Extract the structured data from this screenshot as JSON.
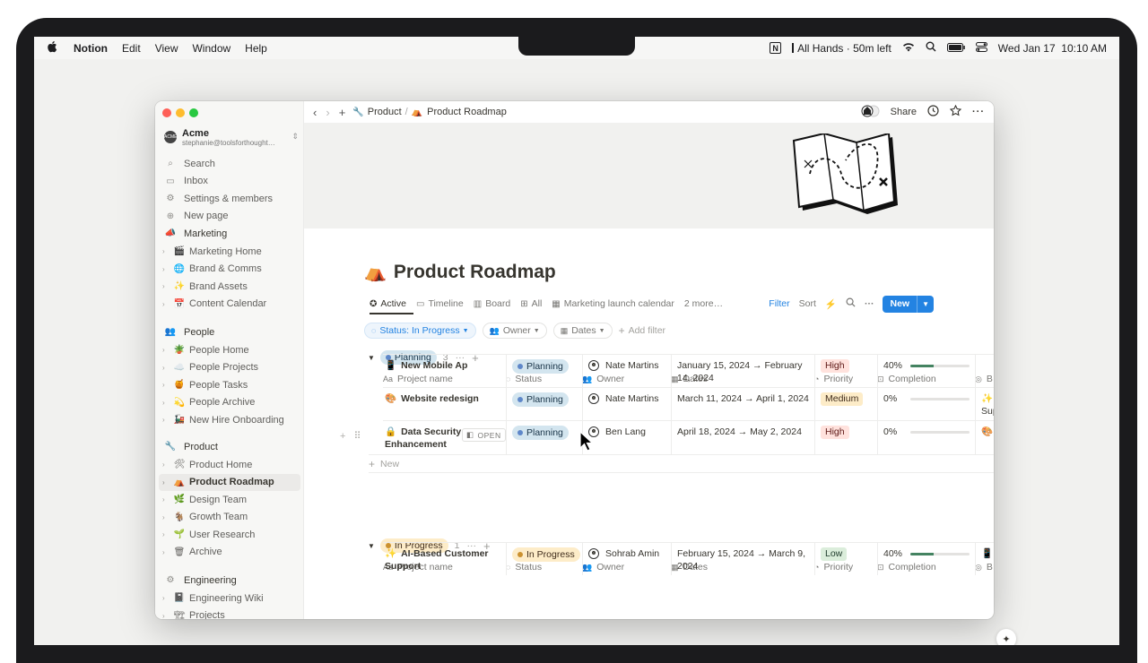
{
  "menubar": {
    "app": "Notion",
    "items": [
      "Edit",
      "View",
      "Window",
      "Help"
    ],
    "meeting": "All Hands · 50m left",
    "datetime": "Wed Jan 17  10:10 AM"
  },
  "workspace": {
    "name": "Acme",
    "email": "stephanie@toolsforthought…",
    "logo_text": "ACME"
  },
  "sidebar": {
    "top": [
      {
        "label": "Search",
        "icon": "search-icon"
      },
      {
        "label": "Inbox",
        "icon": "inbox-icon"
      },
      {
        "label": "Settings & members",
        "icon": "gear-icon"
      },
      {
        "label": "New page",
        "icon": "plus-circle-icon"
      }
    ],
    "sections": [
      {
        "title": "Marketing",
        "items": [
          "Marketing Home",
          "Brand & Comms",
          "Brand Assets",
          "Content Calendar"
        ]
      },
      {
        "title": "People",
        "items": [
          "People Home",
          "People Projects",
          "People Tasks",
          "People Archive",
          "New Hire Onboarding"
        ]
      },
      {
        "title": "Product",
        "items": [
          "Product Home",
          "Product Roadmap",
          "Design Team",
          "Growth Team",
          "User Research",
          "Archive"
        ]
      },
      {
        "title": "Engineering",
        "items": [
          "Engineering Wiki",
          "Projects"
        ]
      }
    ],
    "selected": "Product Roadmap"
  },
  "topbar": {
    "crumb_parent": "Product",
    "crumb_sep": "/",
    "crumb_current": "Product Roadmap",
    "share": "Share"
  },
  "page": {
    "title": "Product Roadmap",
    "title_icon": "⛺"
  },
  "views": {
    "tabs": [
      {
        "label": "Active",
        "icon": "target-icon"
      },
      {
        "label": "Timeline",
        "icon": "timeline-icon"
      },
      {
        "label": "Board",
        "icon": "board-icon"
      },
      {
        "label": "All",
        "icon": "table-icon"
      },
      {
        "label": "Marketing launch calendar",
        "icon": "calendar-icon"
      },
      {
        "label": "2 more…",
        "icon": ""
      }
    ],
    "active": "Active",
    "filter": "Filter",
    "sort": "Sort",
    "new": "New"
  },
  "filters": {
    "status": "Status: In Progress",
    "owner": "Owner",
    "dates": "Dates",
    "add": "Add filter"
  },
  "columns": [
    "Project name",
    "Status",
    "Owner",
    "Dates",
    "Priority",
    "Completion",
    "B"
  ],
  "groups": [
    {
      "label": "Planning",
      "count": "3",
      "rows": [
        {
          "name": "New Mobile Ap",
          "emoji": "📱",
          "status": "Planning",
          "owner": "Nate Martins",
          "dates1": "January 15, 2024 → February",
          "dates2": "14, 2024",
          "priority": "High",
          "completion": "40%",
          "completion_value": 0.4,
          "related": ""
        },
        {
          "name": "Website redesign",
          "emoji": "🎨",
          "status": "Planning",
          "owner": "Nate Martins",
          "dates1": "March 11, 2024 → April 1, 2024",
          "dates2": "",
          "priority": "Medium",
          "completion": "0%",
          "completion_value": 0,
          "related": "✨ A"
        },
        {
          "name": "Data Security",
          "name2": "Enhancement",
          "emoji": "🔒",
          "status": "Planning",
          "owner": "Ben Lang",
          "dates1": "April 18, 2024 → May 2, 2024",
          "dates2": "",
          "priority": "High",
          "completion": "0%",
          "completion_value": 0,
          "related": "🎨 W"
        }
      ],
      "new_label": "New"
    },
    {
      "label": "In Progress",
      "count": "1",
      "rows": [
        {
          "name": "AI-Based Customer",
          "name2": "Support",
          "emoji": "✨",
          "status": "In Progress",
          "owner": "Sohrab Amin",
          "dates1": "February 15, 2024 → March 9,",
          "dates2": "2024",
          "priority": "Low",
          "completion": "40%",
          "completion_value": 0.4,
          "related": "📱 N"
        }
      ]
    }
  ],
  "misc": {
    "open_badge": "OPEN",
    "related_extra": "Supp",
    "planning_status_partial": "Planni"
  }
}
